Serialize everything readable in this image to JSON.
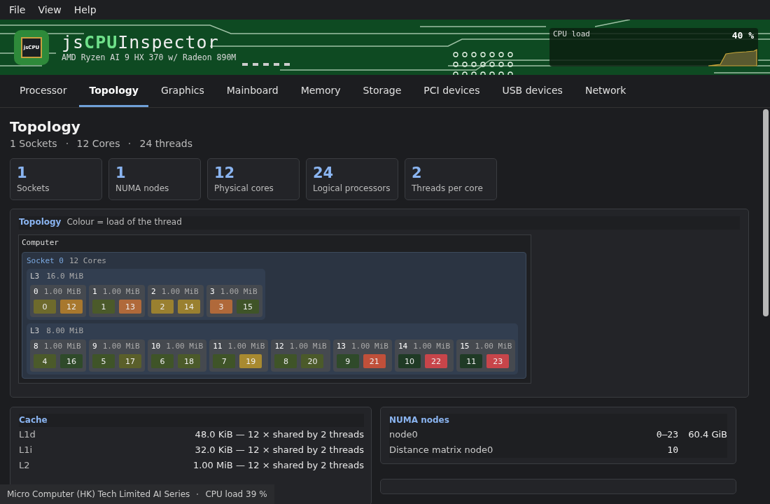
{
  "menu": [
    "File",
    "View",
    "Help"
  ],
  "banner": {
    "logo_text": "jsCPU",
    "title_prefix": "js",
    "title_accent": "CPU",
    "title_rest": "Inspector",
    "subtitle": "AMD Ryzen AI 9 HX 370 w/ Radeon 890M",
    "load_label": "CPU load",
    "load_value": "40 %"
  },
  "tabs": [
    {
      "label": "Processor",
      "selected": false
    },
    {
      "label": "Topology",
      "selected": true
    },
    {
      "label": "Graphics",
      "selected": false
    },
    {
      "label": "Mainboard",
      "selected": false
    },
    {
      "label": "Memory",
      "selected": false
    },
    {
      "label": "Storage",
      "selected": false
    },
    {
      "label": "PCI devices",
      "selected": false
    },
    {
      "label": "USB devices",
      "selected": false
    },
    {
      "label": "Network",
      "selected": false
    }
  ],
  "page": {
    "title": "Topology",
    "summary": [
      "1 Sockets",
      "12 Cores",
      "24 threads"
    ]
  },
  "stats": [
    {
      "value": "1",
      "label": "Sockets"
    },
    {
      "value": "1",
      "label": "NUMA nodes"
    },
    {
      "value": "12",
      "label": "Physical cores"
    },
    {
      "value": "24",
      "label": "Logical processors"
    },
    {
      "value": "2",
      "label": "Threads per core"
    }
  ],
  "topology": {
    "title": "Topology",
    "legend": "Colour = load of the thread",
    "computer": "Computer",
    "socket": {
      "label": "Socket 0",
      "cores": "12 Cores",
      "l3_groups": [
        {
          "label": "L3",
          "size": "16.0 MiB",
          "cores": [
            {
              "id": "0",
              "cache": "1.00 MiB",
              "threads": [
                {
                  "id": "0",
                  "color": "#6e6a2c"
                },
                {
                  "id": "12",
                  "color": "#a8782e"
                }
              ]
            },
            {
              "id": "1",
              "cache": "1.00 MiB",
              "threads": [
                {
                  "id": "1",
                  "color": "#4b5a2a"
                },
                {
                  "id": "13",
                  "color": "#b0693a"
                }
              ]
            },
            {
              "id": "2",
              "cache": "1.00 MiB",
              "threads": [
                {
                  "id": "2",
                  "color": "#9a8030"
                },
                {
                  "id": "14",
                  "color": "#9a8030"
                }
              ]
            },
            {
              "id": "3",
              "cache": "1.00 MiB",
              "threads": [
                {
                  "id": "3",
                  "color": "#b0693a"
                },
                {
                  "id": "15",
                  "color": "#3f5428"
                }
              ]
            }
          ]
        },
        {
          "label": "L3",
          "size": "8.00 MiB",
          "cores": [
            {
              "id": "8",
              "cache": "1.00 MiB",
              "threads": [
                {
                  "id": "4",
                  "color": "#4b5a2a"
                },
                {
                  "id": "16",
                  "color": "#2f4a2a"
                }
              ]
            },
            {
              "id": "9",
              "cache": "1.00 MiB",
              "threads": [
                {
                  "id": "5",
                  "color": "#3f5428"
                },
                {
                  "id": "17",
                  "color": "#5a5f2a"
                }
              ]
            },
            {
              "id": "10",
              "cache": "1.00 MiB",
              "threads": [
                {
                  "id": "6",
                  "color": "#3f5428"
                },
                {
                  "id": "18",
                  "color": "#4b5a2a"
                }
              ]
            },
            {
              "id": "11",
              "cache": "1.00 MiB",
              "threads": [
                {
                  "id": "7",
                  "color": "#3f5428"
                },
                {
                  "id": "19",
                  "color": "#a88a30"
                }
              ]
            },
            {
              "id": "12",
              "cache": "1.00 MiB",
              "threads": [
                {
                  "id": "8",
                  "color": "#3f5428"
                },
                {
                  "id": "20",
                  "color": "#4b5a2a"
                }
              ]
            },
            {
              "id": "13",
              "cache": "1.00 MiB",
              "threads": [
                {
                  "id": "9",
                  "color": "#2f4a2a"
                },
                {
                  "id": "21",
                  "color": "#c0503a"
                }
              ]
            },
            {
              "id": "14",
              "cache": "1.00 MiB",
              "threads": [
                {
                  "id": "10",
                  "color": "#1f3a25"
                },
                {
                  "id": "22",
                  "color": "#c8454a"
                }
              ]
            },
            {
              "id": "15",
              "cache": "1.00 MiB",
              "threads": [
                {
                  "id": "11",
                  "color": "#1f3a25"
                },
                {
                  "id": "23",
                  "color": "#c8454a"
                }
              ]
            }
          ]
        }
      ]
    }
  },
  "cache": {
    "title": "Cache",
    "rows": [
      {
        "label": "L1d",
        "value": "48.0 KiB  —  12 × shared by 2 threads"
      },
      {
        "label": "L1i",
        "value": "32.0 KiB  —  12 × shared by 2 threads"
      },
      {
        "label": "L2",
        "value": "1.00 MiB  —  12 × shared by 2 threads"
      }
    ]
  },
  "numa": {
    "title": "NUMA nodes",
    "rows": [
      {
        "label": "node0",
        "cpus": "0–23",
        "size": "60.4 GiB"
      },
      {
        "label": "Distance matrix node0",
        "cpus": "10"
      }
    ]
  },
  "status_bar": [
    "Micro Computer (HK) Tech Limited AI Series",
    "CPU load 39 %"
  ]
}
